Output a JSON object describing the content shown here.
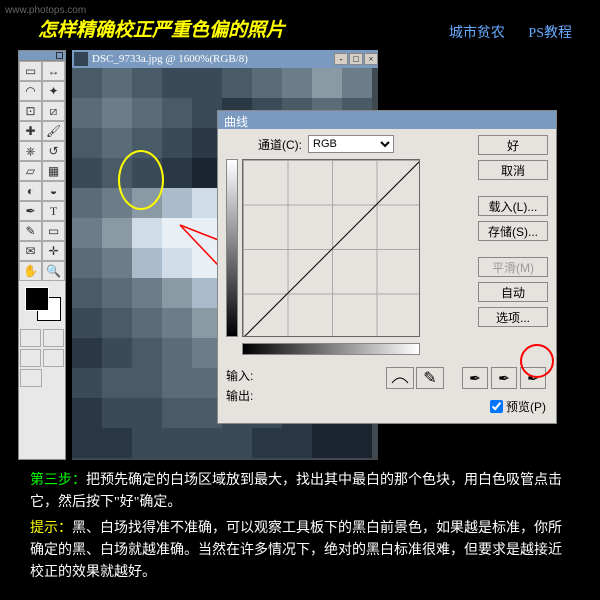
{
  "watermark": "www.photops.com",
  "title": "怎样精确校正严重色偏的照片",
  "links": {
    "a": "城市贫农",
    "b": "PS教程"
  },
  "canvasTitle": "DSC_9733a.jpg @ 1600%(RGB/8)",
  "curves": {
    "title": "曲线",
    "channelLabel": "通道(C):",
    "channelValue": "RGB",
    "inputLabel": "输入:",
    "outputLabel": "输出:",
    "previewLabel": "预览(P)",
    "buttons": {
      "ok": "好",
      "cancel": "取消",
      "load": "载入(L)...",
      "save": "存储(S)...",
      "smooth": "平滑(M)",
      "auto": "自动",
      "options": "选项..."
    }
  },
  "tools": {
    "move": "↔",
    "marquee": "▭",
    "lasso": "◠",
    "wand": "✦",
    "crop": "⊡",
    "slice": "⧄",
    "heal": "✚",
    "brush": "🖌",
    "stamp": "⎈",
    "history": "↺",
    "eraser": "▱",
    "grad": "▦",
    "blur": "◐",
    "dodge": "◒",
    "path": "✒",
    "type": "T",
    "pen": "✎",
    "shape": "▭",
    "notes": "✉",
    "eye": "✛",
    "hand": "✋",
    "zoom": "🔍"
  },
  "instruction": {
    "stepLabel": "第三步：",
    "stepText": "把预先确定的白场区域放到最大，找出其中最白的那个色块，用白色吸管点击它，然后按下\"好\"确定。",
    "tipLabel": "提示：",
    "tipText": "黑、白场找得准不准确，可以观察工具板下的黑白前景色，如果越是标准，你所确定的黑、白场就越准确。当然在许多情况下，绝对的黑白标准很难，但要求是越接近校正的效果就越好。"
  }
}
